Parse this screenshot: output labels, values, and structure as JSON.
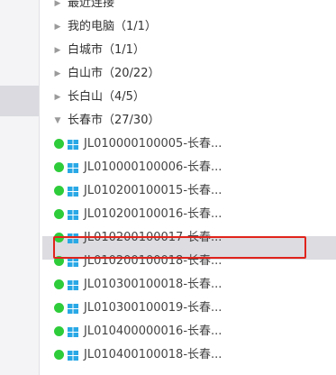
{
  "tree": {
    "groups_before": [
      {
        "label": "最近连接",
        "expanded": false
      },
      {
        "label": "我的电脑（1/1）",
        "expanded": false
      },
      {
        "label": "白城市（1/1）",
        "expanded": false
      },
      {
        "label": "白山市（20/22）",
        "expanded": false
      },
      {
        "label": "长白山（4/5）",
        "expanded": false
      }
    ],
    "open_group": {
      "label": "长春市（27/30）",
      "expanded": true
    },
    "hosts": [
      {
        "label": "JL010000100005-长春...",
        "status": "online",
        "os": "windows-icon"
      },
      {
        "label": "JL010000100006-长春...",
        "status": "online",
        "os": "windows-icon"
      },
      {
        "label": "JL010200100015-长春...",
        "status": "online",
        "os": "windows-icon"
      },
      {
        "label": "JL010200100016-长春...",
        "status": "online",
        "os": "windows-icon"
      },
      {
        "label": "JL010200100017-长春...",
        "status": "online",
        "os": "windows-icon",
        "selected": true
      },
      {
        "label": "JL010200100018-长春...",
        "status": "online",
        "os": "windows-icon"
      },
      {
        "label": "JL010300100018-长春...",
        "status": "online",
        "os": "windows-icon"
      },
      {
        "label": "JL010300100019-长春...",
        "status": "online",
        "os": "windows-icon"
      },
      {
        "label": "JL010400000016-长春...",
        "status": "online",
        "os": "windows-icon"
      },
      {
        "label": "JL010400100018-长春...",
        "status": "online",
        "os": "windows-icon"
      }
    ]
  },
  "colors": {
    "online": "#2ecc3a",
    "windows": "#29a8e6",
    "selection_border": "#e0241c",
    "selected_bg": "#dcdce1"
  }
}
